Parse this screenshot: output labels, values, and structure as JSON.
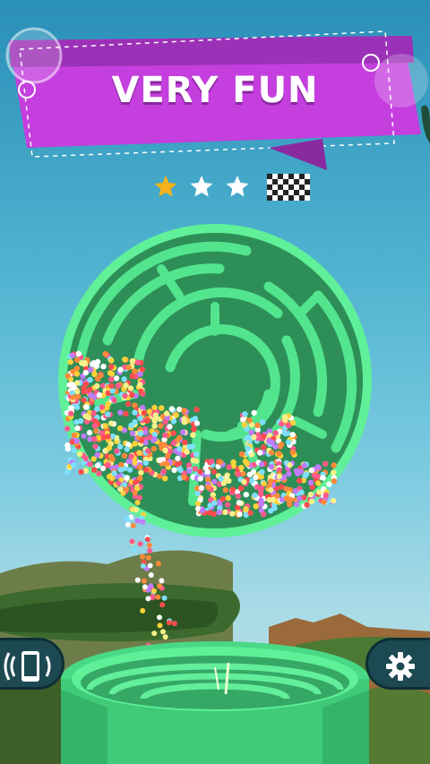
{
  "banner": {
    "title": "VERY FUN",
    "colors": {
      "ribbon": "#b83ad0",
      "ribbon_light": "#d44fe8",
      "ribbon_dark": "#8a2aa0"
    }
  },
  "level_progress": {
    "stars_earned": 1,
    "stars_total": 3,
    "finish_icon": "checkered-flag-icon",
    "colors": {
      "gold": "#f5b21a",
      "white": "#ffffff"
    }
  },
  "maze": {
    "color": "#3fdc7c",
    "wall_color": "#5cf095",
    "floor_color": "#2f8a58"
  },
  "controls": {
    "vibration_icon": "phone-vibration-icon",
    "settings_icon": "gear-icon"
  }
}
